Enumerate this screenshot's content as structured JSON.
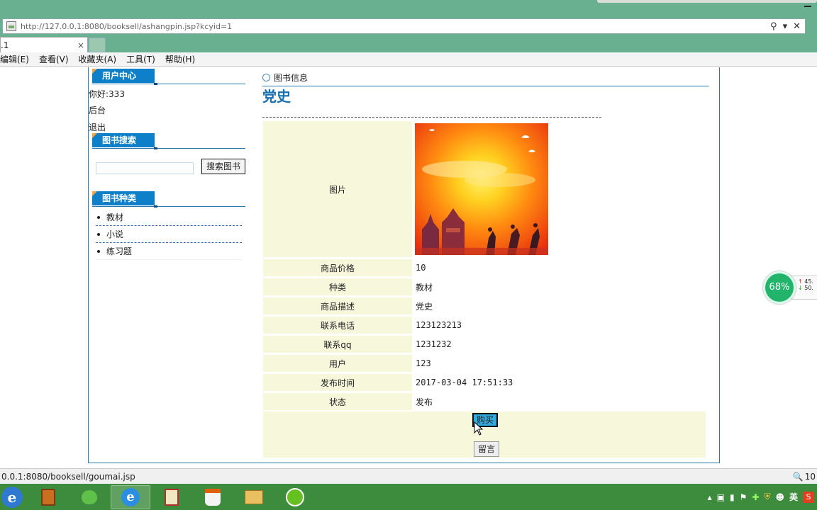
{
  "browser": {
    "url_host": "http://127.0.0.1",
    "url_rest": ":8080/booksell/ashangpin.jsp?kcyid=1",
    "tab_title": ".1",
    "tab_close": "×",
    "menu": [
      "编辑(E)",
      "查看(V)",
      "收藏夹(A)",
      "工具(T)",
      "帮助(H)"
    ],
    "status_url": "0.0.1:8080/booksell/goumai.jsp",
    "zoom": "10"
  },
  "sidebar": {
    "user_center": {
      "title": "用户中心",
      "greeting": "你好:333",
      "admin": "后台",
      "logout": "退出"
    },
    "search": {
      "title": "图书搜索",
      "button": "搜索图书",
      "value": ""
    },
    "categories": {
      "title": "图书种类",
      "items": [
        "教材",
        "小说",
        "练习题"
      ]
    }
  },
  "main": {
    "crumb": "图书信息",
    "book_title": "党史",
    "details": {
      "image_label": "图片",
      "price_label": "商品价格",
      "price": "10",
      "kind_label": "种类",
      "kind": "教材",
      "desc_label": "商品描述",
      "desc": "党史",
      "phone_label": "联系电话",
      "phone": "123123213",
      "qq_label": "联系qq",
      "qq": "1231232",
      "user_label": "用户",
      "user": "123",
      "time_label": "发布时间",
      "time": "2017-03-04 17:51:33",
      "state_label": "状态",
      "state": "发布"
    },
    "buy_button": "购买",
    "message_button": "留言"
  },
  "widget": {
    "percent": "68%",
    "up": "45.",
    "down": "50."
  },
  "tray": {
    "lang": "英"
  }
}
